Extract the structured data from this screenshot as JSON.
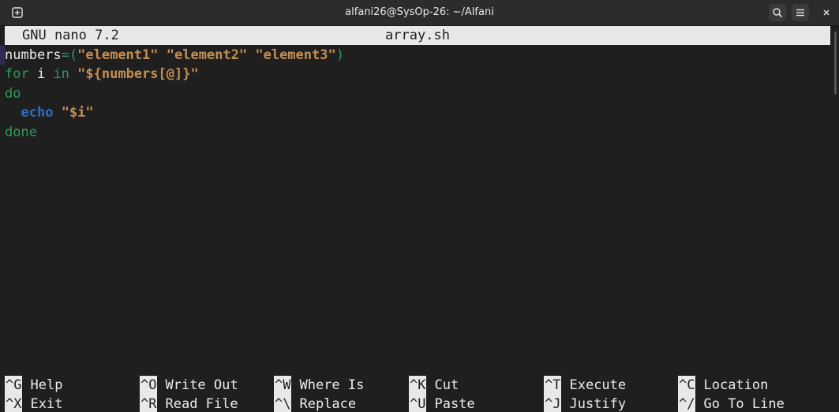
{
  "window": {
    "title": "alfani26@SysOp-26: ~/Alfani"
  },
  "nano": {
    "version": "GNU nano 7.2",
    "filename": "array.sh"
  },
  "code": {
    "line1": {
      "a": "numbers",
      "b": "=(",
      "c": "\"element1\"",
      "d": " ",
      "e": "\"element2\"",
      "f": " ",
      "g": "\"element3\"",
      "h": ")"
    },
    "line2": {
      "a": "for",
      "b": " i ",
      "c": "in",
      "d": " ",
      "e": "\"${numbers[@]}\""
    },
    "line3": {
      "a": "do"
    },
    "line4": {
      "a": "  ",
      "b": "echo",
      "c": " ",
      "d": "\"$i\""
    },
    "line5": {
      "a": "done"
    }
  },
  "shortcuts": [
    {
      "key": "^G",
      "label": "Help"
    },
    {
      "key": "^O",
      "label": "Write Out"
    },
    {
      "key": "^W",
      "label": "Where Is"
    },
    {
      "key": "^K",
      "label": "Cut"
    },
    {
      "key": "^T",
      "label": "Execute"
    },
    {
      "key": "^C",
      "label": "Location"
    },
    {
      "key": "^X",
      "label": "Exit"
    },
    {
      "key": "^R",
      "label": "Read File"
    },
    {
      "key": "^\\",
      "label": "Replace"
    },
    {
      "key": "^U",
      "label": "Paste"
    },
    {
      "key": "^J",
      "label": "Justify"
    },
    {
      "key": "^/",
      "label": "Go To Line"
    }
  ],
  "icons": {
    "new_tab": "new-tab-icon",
    "search": "search-icon",
    "menu": "hamburger-menu-icon",
    "close": "close-icon"
  },
  "colors": {
    "background": "#1f1f1f",
    "header_bg": "#e8e8e8",
    "keyword_green": "#2f9a58",
    "string_orange": "#c58e55",
    "builtin_blue": "#2d6fc6"
  }
}
